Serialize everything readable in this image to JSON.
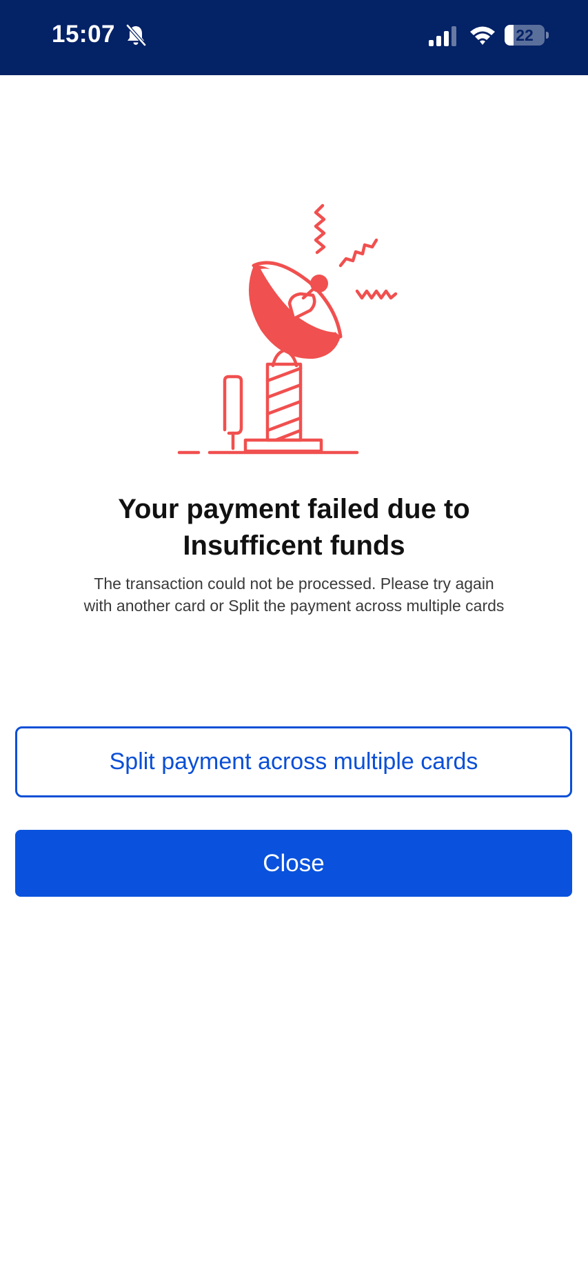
{
  "status_bar": {
    "time": "15:07",
    "battery_level": "22",
    "battery_fraction": 0.22,
    "icons": [
      "bell-slash-icon",
      "signal-icon",
      "wifi-icon",
      "battery-icon"
    ]
  },
  "illustration": {
    "icon": "satellite-dish-icon",
    "color": "#f0504f"
  },
  "dialog": {
    "title_line1": "Your payment failed due to",
    "title_line2": "Insufficent funds",
    "message_line1": "The transaction could not be processed. Please try again",
    "message_line2": "with another card or Split the payment across multiple cards"
  },
  "actions": {
    "split_label": "Split payment across multiple cards",
    "close_label": "Close"
  },
  "colors": {
    "status_bar_bg": "#042266",
    "primary": "#0a52dd",
    "illustration": "#f0504f"
  }
}
